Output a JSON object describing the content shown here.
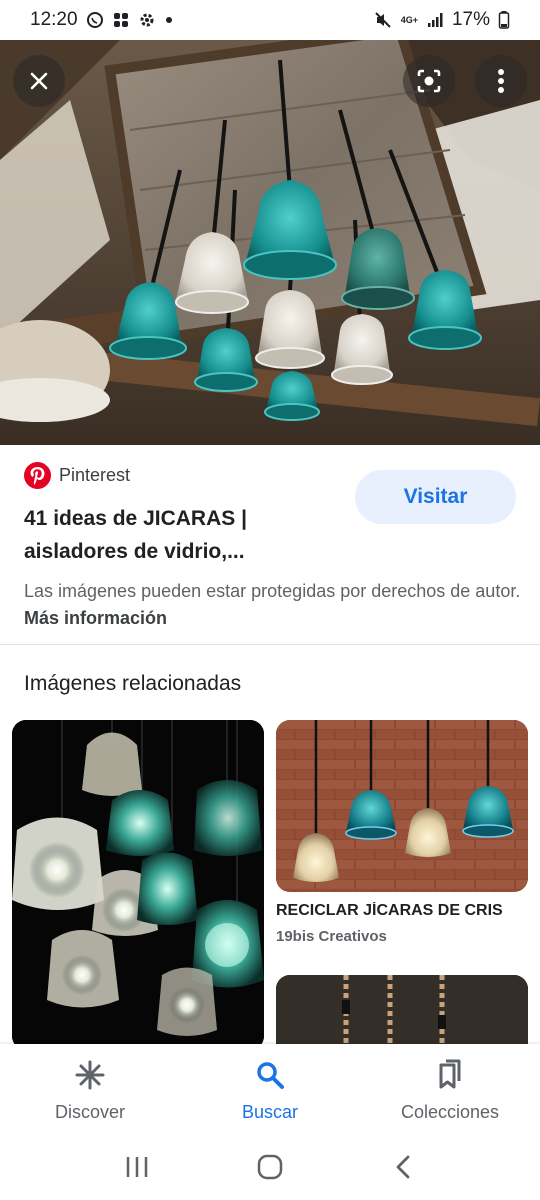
{
  "status": {
    "time": "12:20",
    "network": "4G+",
    "battery": "17%",
    "left_icons": [
      "whatsapp-icon",
      "slack-icon",
      "settings-icon",
      "dot-icon"
    ],
    "right_icons": [
      "mute-icon",
      "network-icon",
      "signal-icon",
      "battery-icon"
    ]
  },
  "viewer": {
    "close_icon": "close-icon",
    "lens_icon": "lens-icon",
    "more_icon": "more-vert-icon"
  },
  "result": {
    "source": "Pinterest",
    "title": "41 ideas de JICARAS | aisladores de vidrio,...",
    "visit_label": "Visitar",
    "copyright_text": "Las imágenes pueden estar protegidas por derechos de autor.",
    "more_info": "Más información"
  },
  "related": {
    "heading": "Imágenes relacionadas",
    "items": [
      {
        "caption": "",
        "source": ""
      },
      {
        "caption": "RECICLAR JÍCARAS DE CRIS",
        "source": "19bis Creativos"
      }
    ]
  },
  "bottom_nav": {
    "items": [
      {
        "label": "Discover",
        "icon": "discover-icon",
        "active": false
      },
      {
        "label": "Buscar",
        "icon": "search-icon",
        "active": true
      },
      {
        "label": "Colecciones",
        "icon": "collections-icon",
        "active": false
      }
    ]
  },
  "system_nav": [
    "recents-icon",
    "home-icon",
    "back-icon"
  ],
  "colors": {
    "accent": "#1a73e8",
    "visit_bg": "#e8f0fe",
    "pinterest": "#e60023"
  }
}
